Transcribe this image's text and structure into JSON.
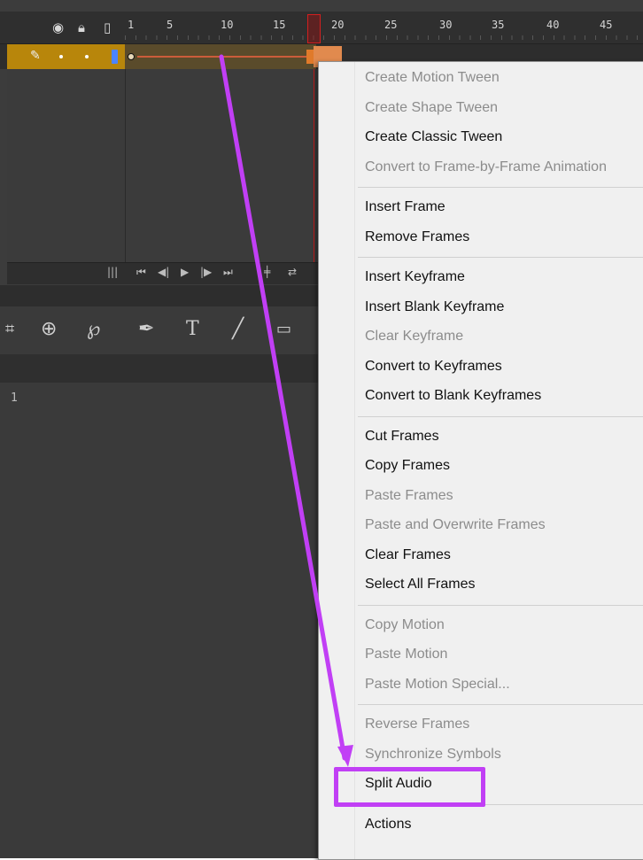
{
  "timeline": {
    "frame_numbers": [
      "1",
      "5",
      "10",
      "15",
      "20",
      "25",
      "30",
      "35",
      "40",
      "45"
    ],
    "current_frame": 19,
    "layer_line_number": "1"
  },
  "icons": {
    "eye": "eye-icon",
    "lock": "lock-icon",
    "outline": "outline-icon",
    "pencil": "pencil-icon",
    "pen_tool": "pen-tool-icon",
    "text_tool": "text-tool-icon",
    "line_tool": "line-tool-icon",
    "rectangle_tool": "rectangle-tool-icon",
    "lasso_tool": "lasso-tool-icon",
    "3d_rotation_tool": "3d-rotation-icon",
    "transform_tool": "free-transform-icon"
  },
  "context_menu": {
    "groups": [
      [
        {
          "label": "Create Motion Tween",
          "enabled": false
        },
        {
          "label": "Create Shape Tween",
          "enabled": false
        },
        {
          "label": "Create Classic Tween",
          "enabled": true
        },
        {
          "label": "Convert to Frame-by-Frame Animation",
          "enabled": false
        }
      ],
      [
        {
          "label": "Insert Frame",
          "enabled": true
        },
        {
          "label": "Remove Frames",
          "enabled": true
        }
      ],
      [
        {
          "label": "Insert Keyframe",
          "enabled": true
        },
        {
          "label": "Insert Blank Keyframe",
          "enabled": true
        },
        {
          "label": "Clear Keyframe",
          "enabled": false
        },
        {
          "label": "Convert to Keyframes",
          "enabled": true
        },
        {
          "label": "Convert to Blank Keyframes",
          "enabled": true
        }
      ],
      [
        {
          "label": "Cut Frames",
          "enabled": true
        },
        {
          "label": "Copy Frames",
          "enabled": true
        },
        {
          "label": "Paste Frames",
          "enabled": false
        },
        {
          "label": "Paste and Overwrite Frames",
          "enabled": false
        },
        {
          "label": "Clear Frames",
          "enabled": true
        },
        {
          "label": "Select All Frames",
          "enabled": true
        }
      ],
      [
        {
          "label": "Copy Motion",
          "enabled": false
        },
        {
          "label": "Paste Motion",
          "enabled": false
        },
        {
          "label": "Paste Motion Special...",
          "enabled": false
        }
      ],
      [
        {
          "label": "Reverse Frames",
          "enabled": false
        },
        {
          "label": "Synchronize Symbols",
          "enabled": false
        },
        {
          "label": "Split Audio",
          "enabled": true
        }
      ],
      [
        {
          "label": "Actions",
          "enabled": true
        }
      ]
    ],
    "highlighted_item": "Split Audio"
  },
  "colors": {
    "annotation": "#c13ff5",
    "playhead": "#d21f1f",
    "layer_highlight": "#b8860b",
    "tween_line": "#cc5c3a"
  }
}
